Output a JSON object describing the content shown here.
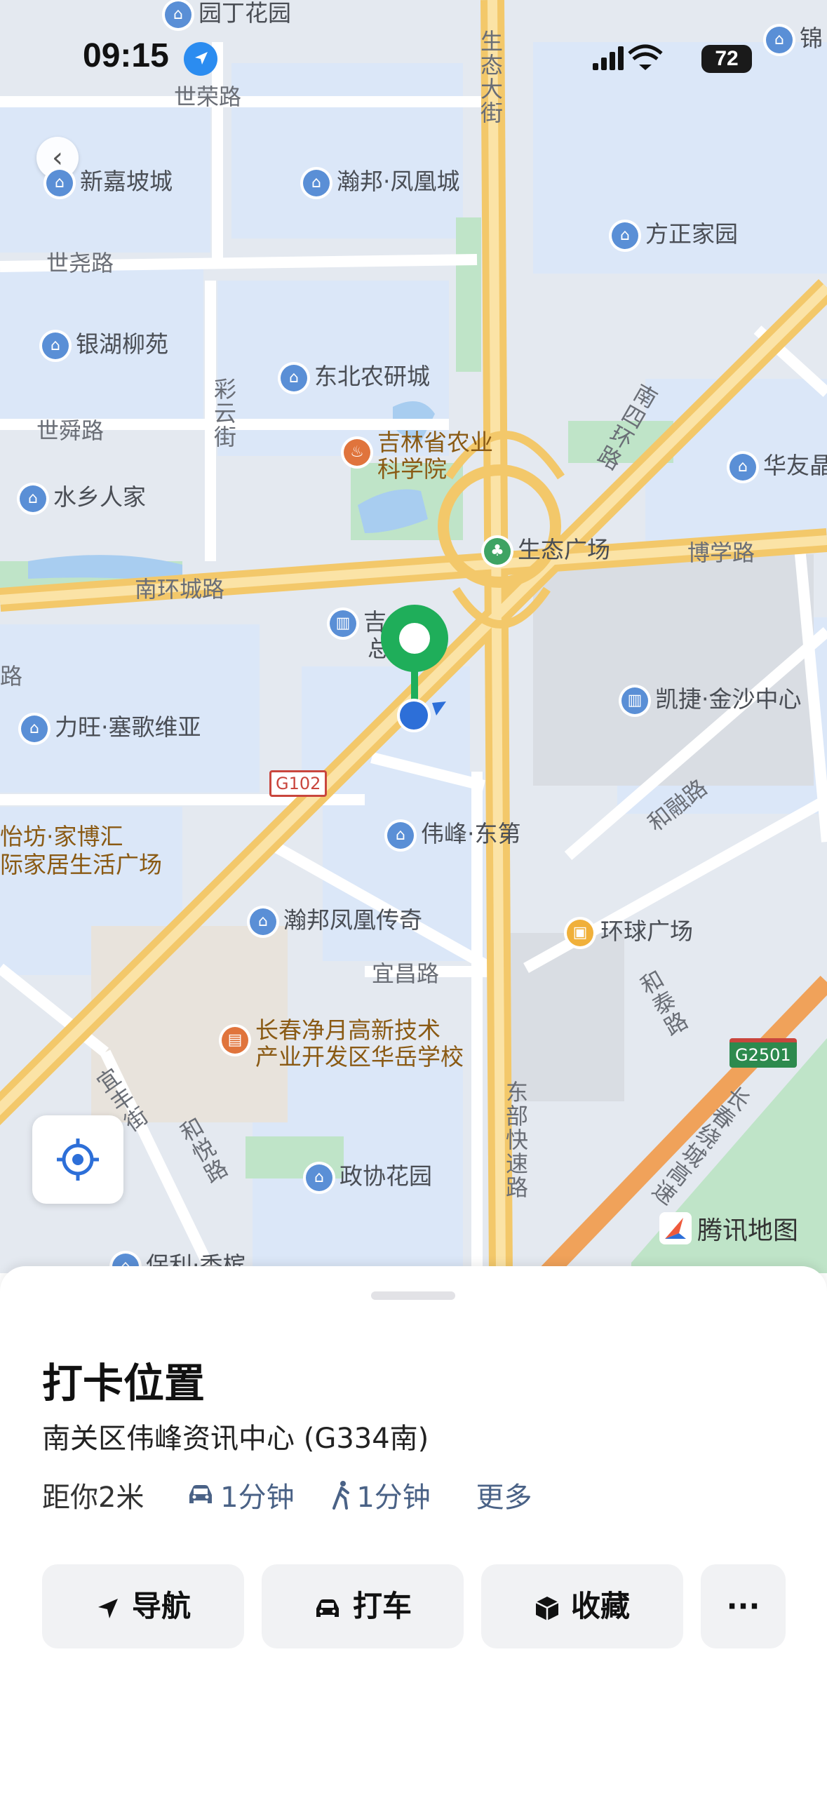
{
  "status_bar": {
    "time": "09:15",
    "battery": "72"
  },
  "map": {
    "labels": {
      "yuanding": "园丁花园",
      "jin": "锦",
      "shirong": "世荣路",
      "xinjiapo": "新嘉坡城",
      "hanbang": "瀚邦·凤凰城",
      "fangzheng": "方正家园",
      "shiyao": "世尧路",
      "yinhu": "银湖柳苑",
      "dongbei": "东北农研城",
      "shishun": "世舜路",
      "jilin": "吉林省农业\n科学院",
      "shuixiang": "水乡人家",
      "huayou": "华友晶",
      "shengtai_sq": "生态广场",
      "boxue": "博学路",
      "nanhuan": "南环城路",
      "jicao": "吉  草",
      "jicao2": "总  厦",
      "lu": "路",
      "kaijie": "凯捷·金沙中心",
      "liwang": "力旺·塞歌维亚",
      "g102": "G102",
      "herong": "和融路",
      "weifeng": "伟峰·东第",
      "yifang": "怡坊·家博汇",
      "jiaju": "际家居生活广场",
      "hanbang2": "瀚邦凤凰传奇",
      "huanqiu": "环球广场",
      "yichang": "宜昌路",
      "changchun": "长春净月高新技术\n产业开发区华岳学校",
      "g2501": "G2501",
      "zhengxie": "政协花园",
      "baoli": "保利·香槟",
      "brand": "腾讯地图",
      "shengtai_v": "生态大街",
      "caiyun_v": "彩云街",
      "nansi_v": "南四环路",
      "dongbu_v": "东部快速路",
      "hetai_v": "和泰路",
      "yifeng_v": "宜丰街",
      "heyue_v": "和悦路",
      "changchun_v": "长春绕城高速"
    }
  },
  "sheet": {
    "title": "打卡位置",
    "address": "南关区伟峰资讯中心 (G334南)",
    "distance": "距你2米",
    "drive_time": "1分钟",
    "walk_time": "1分钟",
    "more": "更多",
    "buttons": {
      "nav": "导航",
      "taxi": "打车",
      "fav": "收藏",
      "more": "···"
    }
  },
  "colors": {
    "accent_green": "#1fae5a",
    "user_dot": "#2d6fd8",
    "road_yellow": "#f6d57e",
    "water": "#a8cdf0"
  }
}
